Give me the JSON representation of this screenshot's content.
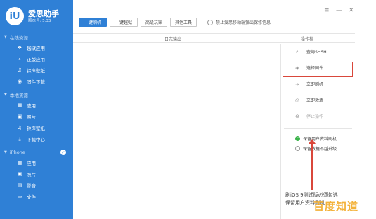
{
  "sidebar": {
    "brand_name": "爱思助手",
    "brand_version": "版本号: 5.33",
    "logo_text": "iU",
    "sections": [
      {
        "title": "在线资源",
        "items": [
          {
            "label": "越狱应用",
            "icon": "app-icon"
          },
          {
            "label": "正版应用",
            "icon": "store-icon"
          },
          {
            "label": "铃声壁纸",
            "icon": "music-icon"
          },
          {
            "label": "固件下载",
            "icon": "firmware-icon"
          }
        ]
      },
      {
        "title": "本地资源",
        "items": [
          {
            "label": "应用",
            "icon": "grid-icon"
          },
          {
            "label": "照片",
            "icon": "photo-icon"
          },
          {
            "label": "铃声壁纸",
            "icon": "music-icon"
          },
          {
            "label": "下载中心",
            "icon": "download-icon"
          }
        ]
      },
      {
        "title": "iPhone",
        "items": [
          {
            "label": "应用",
            "icon": "grid-icon"
          },
          {
            "label": "照片",
            "icon": "photo-icon"
          },
          {
            "label": "影音",
            "icon": "film-icon"
          },
          {
            "label": "文件",
            "icon": "folder-icon"
          }
        ]
      }
    ]
  },
  "toolbar": {
    "buttons": [
      "一键刷机",
      "一键越狱",
      "高级玩家",
      "其他工具"
    ],
    "radio_label": "禁止爱思移动端弹出保修信息"
  },
  "window_controls": [
    "≡",
    "—",
    "✕"
  ],
  "header": {
    "log_title": "日志输出",
    "ops_title": "操作栏"
  },
  "operations": [
    {
      "label": "查询SHSH",
      "icon": "search-icon",
      "disabled": false
    },
    {
      "label": "选择固件",
      "icon": "cube-icon",
      "disabled": false
    },
    {
      "label": "立即刷机",
      "icon": "flash-icon",
      "disabled": false
    },
    {
      "label": "立即激活",
      "icon": "activate-icon",
      "disabled": false
    },
    {
      "label": "停止操作",
      "icon": "stop-icon",
      "disabled": true
    }
  ],
  "options": [
    {
      "label": "保留用户资料刷机",
      "checked": true
    },
    {
      "label": "保留数据不越升级",
      "checked": false
    }
  ],
  "annotation": {
    "line1": "刷iOS 9测试版必须勾选",
    "line2": "保留用户资料刷机"
  },
  "watermark": "百度知道",
  "colors": {
    "accent": "#2f80d6",
    "highlight": "#d9473b",
    "check": "#3bb34a"
  }
}
